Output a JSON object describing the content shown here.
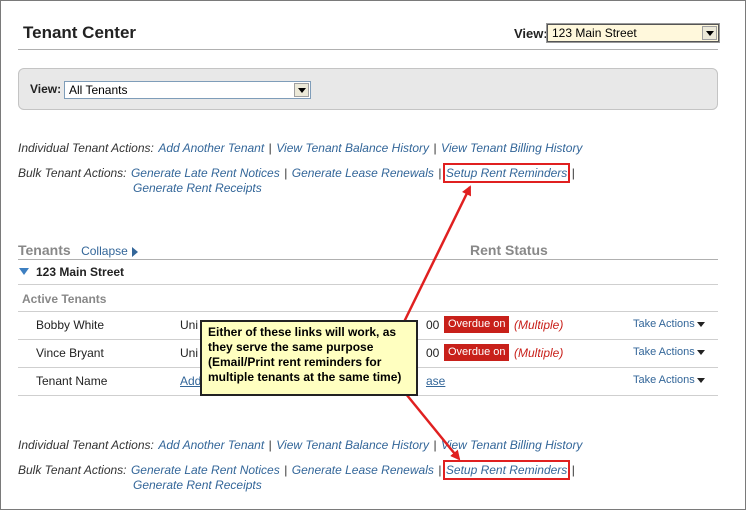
{
  "header": {
    "title": "Tenant Center",
    "view_label": "View:",
    "view_value": "123 Main Street"
  },
  "filter": {
    "label": "View:",
    "value": "All Tenants"
  },
  "actions_top": {
    "individual_label": "Individual Tenant Actions:",
    "individual_links": [
      "Add Another Tenant",
      "View Tenant Balance History",
      "View Tenant Billing History"
    ],
    "bulk_label": "Bulk Tenant Actions:",
    "bulk_links": [
      "Generate Late Rent Notices",
      "Generate Lease Renewals",
      "Setup Rent Reminders"
    ],
    "bulk_second_line": "Generate Rent Receipts",
    "separator": "|"
  },
  "tenants_section": {
    "heading": "Tenants",
    "collapse_label": "Collapse",
    "rent_status_heading": "Rent Status",
    "property": "123 Main Street",
    "active_label": "Active Tenants",
    "rows": [
      {
        "name": "Bobby White",
        "unit": "Uni",
        "amount": "00",
        "badge": "Overdue on",
        "multiple": "(Multiple)",
        "action": "Take Actions"
      },
      {
        "name": "Vince Bryant",
        "unit": "Uni",
        "amount": "00",
        "badge": "Overdue on",
        "multiple": "(Multiple)",
        "action": "Take Actions"
      },
      {
        "name": "Tenant Name",
        "unit": "Add",
        "amount": "ase",
        "badge": "",
        "multiple": "",
        "action": "Take Actions"
      }
    ]
  },
  "callout": {
    "text": "Either of these links will work, as they serve the same purpose (Email/Print rent reminders for multiple tenants at the same time)"
  },
  "actions_bottom": {
    "individual_label": "Individual Tenant Actions:",
    "individual_links": [
      "Add Another Tenant",
      "View Tenant Balance History",
      "View Tenant Billing History"
    ],
    "bulk_label": "Bulk Tenant Actions:",
    "bulk_links": [
      "Generate Late Rent Notices",
      "Generate Lease Renewals",
      "Setup Rent Reminders"
    ],
    "bulk_second_line": "Generate Rent Receipts",
    "separator": "|"
  },
  "colors": {
    "link": "#336699",
    "overdue": "#c8201a",
    "highlight": "#e02020",
    "callout_bg": "#ffffc0"
  },
  "icons": [
    "dropdown-arrow-icon",
    "collapse-arrow-icon",
    "expand-triangle-icon",
    "take-actions-caret-icon"
  ]
}
